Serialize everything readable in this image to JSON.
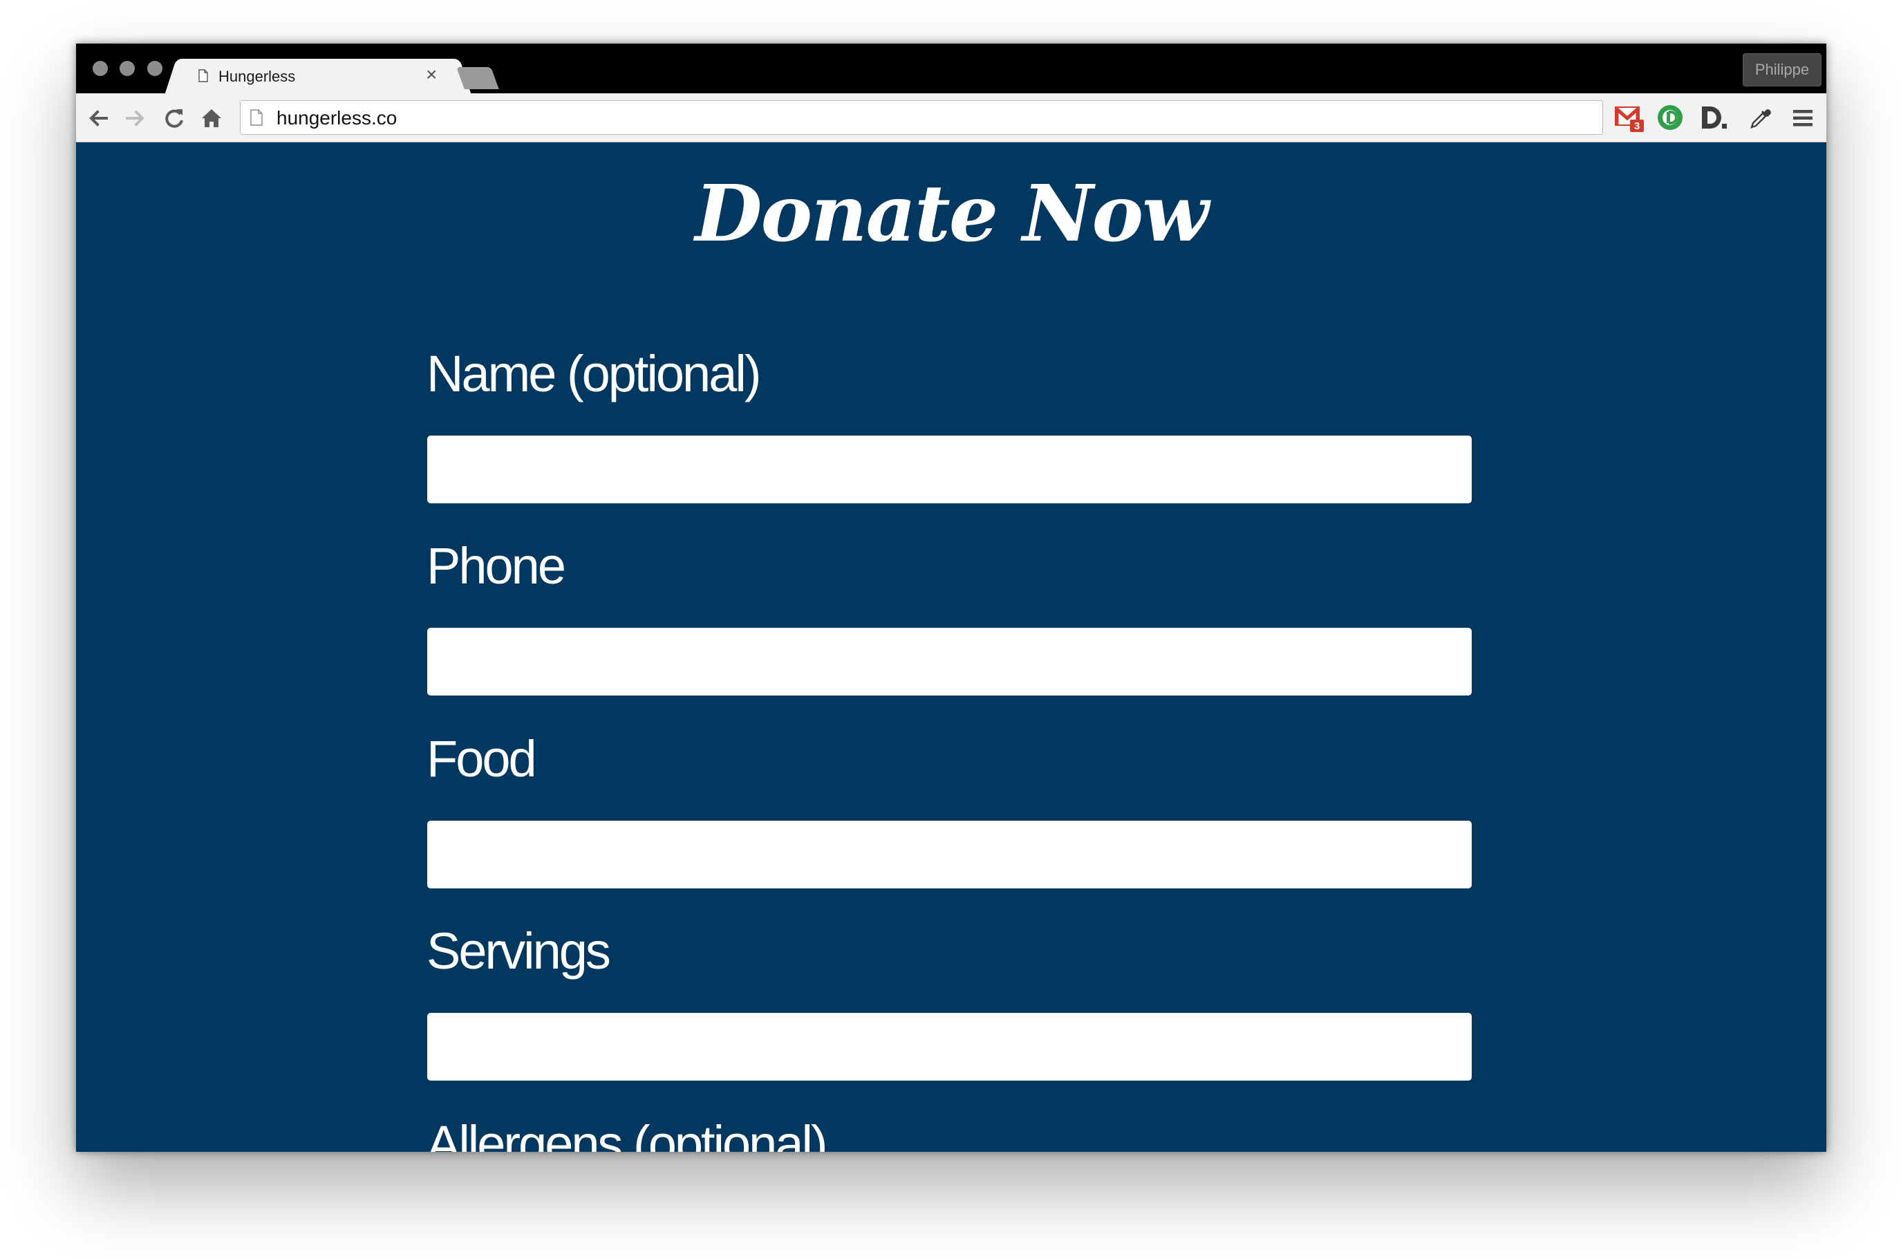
{
  "browser": {
    "tab_title": "Hungerless",
    "tab_close_glyph": "×",
    "url": "hungerless.co",
    "profile_name": "Philippe",
    "extensions": [
      "gmail-icon",
      "extension-d-green-icon",
      "extension-d-dark-icon",
      "eyedropper-icon"
    ],
    "gmail_badge": "3"
  },
  "page": {
    "title": "Donate Now",
    "background_color": "#02375f",
    "fields": [
      {
        "label": "Name (optional)",
        "value": ""
      },
      {
        "label": "Phone",
        "value": ""
      },
      {
        "label": "Food",
        "value": ""
      },
      {
        "label": "Servings",
        "value": ""
      },
      {
        "label": "Allergens (optional)"
      }
    ]
  }
}
